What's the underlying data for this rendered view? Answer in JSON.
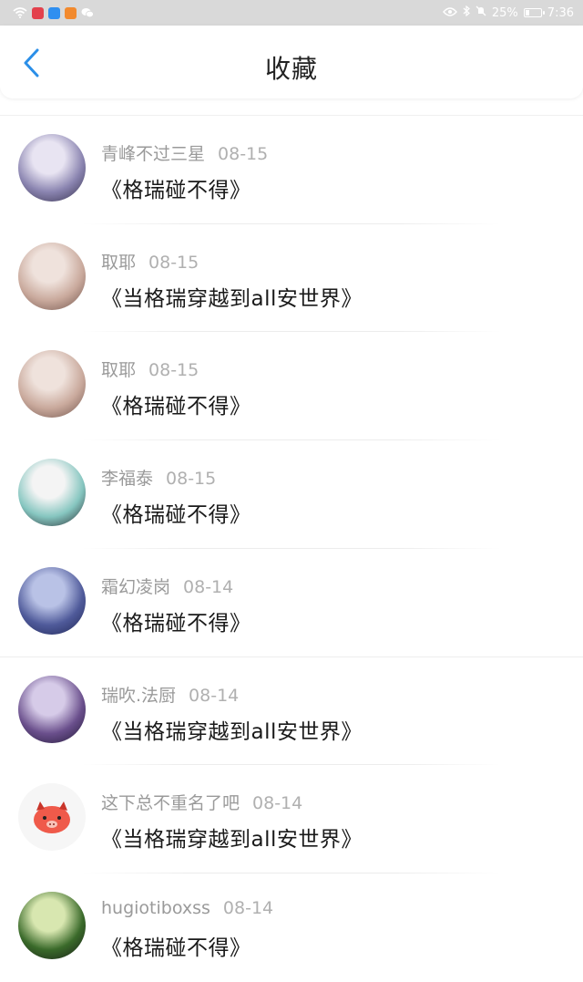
{
  "status_bar": {
    "battery": "25%",
    "time": "7:36",
    "battery_level": 0.25,
    "icons": [
      "wifi-icon",
      "app-red-icon",
      "app-search-icon",
      "app-video-icon",
      "wechat-icon",
      "eye-icon",
      "bluetooth-icon",
      "mute-icon",
      "battery-icon"
    ]
  },
  "header": {
    "title": "收藏",
    "back_icon": "chevron-left-icon",
    "accent": "#2b8fe8"
  },
  "items": [
    {
      "author": "青峰不过三星",
      "date": "08-15",
      "work": "《格瑞碰不得》",
      "avatar_colors": [
        "#e8e4f2",
        "#8a84b0",
        "#2f2a44"
      ]
    },
    {
      "author": "取耶",
      "date": "08-15",
      "work": "《当格瑞穿越到all安世界》",
      "avatar_colors": [
        "#efe2dc",
        "#c9a99c",
        "#6b4e46"
      ]
    },
    {
      "author": "取耶",
      "date": "08-15",
      "work": "《格瑞碰不得》",
      "avatar_colors": [
        "#efe2dc",
        "#c9a99c",
        "#6b4e46"
      ]
    },
    {
      "author": "李福泰",
      "date": "08-15",
      "work": "《格瑞碰不得》",
      "avatar_colors": [
        "#f4f4f4",
        "#86c6c0",
        "#1e1e24"
      ]
    },
    {
      "author": "霜幻凌岗",
      "date": "08-14",
      "work": "《格瑞碰不得》",
      "avatar_colors": [
        "#b9c2e6",
        "#4f5a9a",
        "#1d2350"
      ]
    },
    {
      "author": "瑞吹.法厨",
      "date": "08-14",
      "work": "《当格瑞穿越到all安世界》",
      "avatar_colors": [
        "#d6cbe8",
        "#6a4f8c",
        "#1c1530"
      ]
    },
    {
      "author": "这下总不重名了吧",
      "date": "08-14",
      "work": "《当格瑞穿越到all安世界》",
      "avatar_colors": [
        "#f6f6f6",
        "#ef5a4a",
        "#c9352a"
      ]
    },
    {
      "author": "hugiotiboxss",
      "date": "08-14",
      "work": "《格瑞碰不得》",
      "avatar_colors": [
        "#d8e7b0",
        "#3a6a2a",
        "#151515"
      ]
    }
  ]
}
